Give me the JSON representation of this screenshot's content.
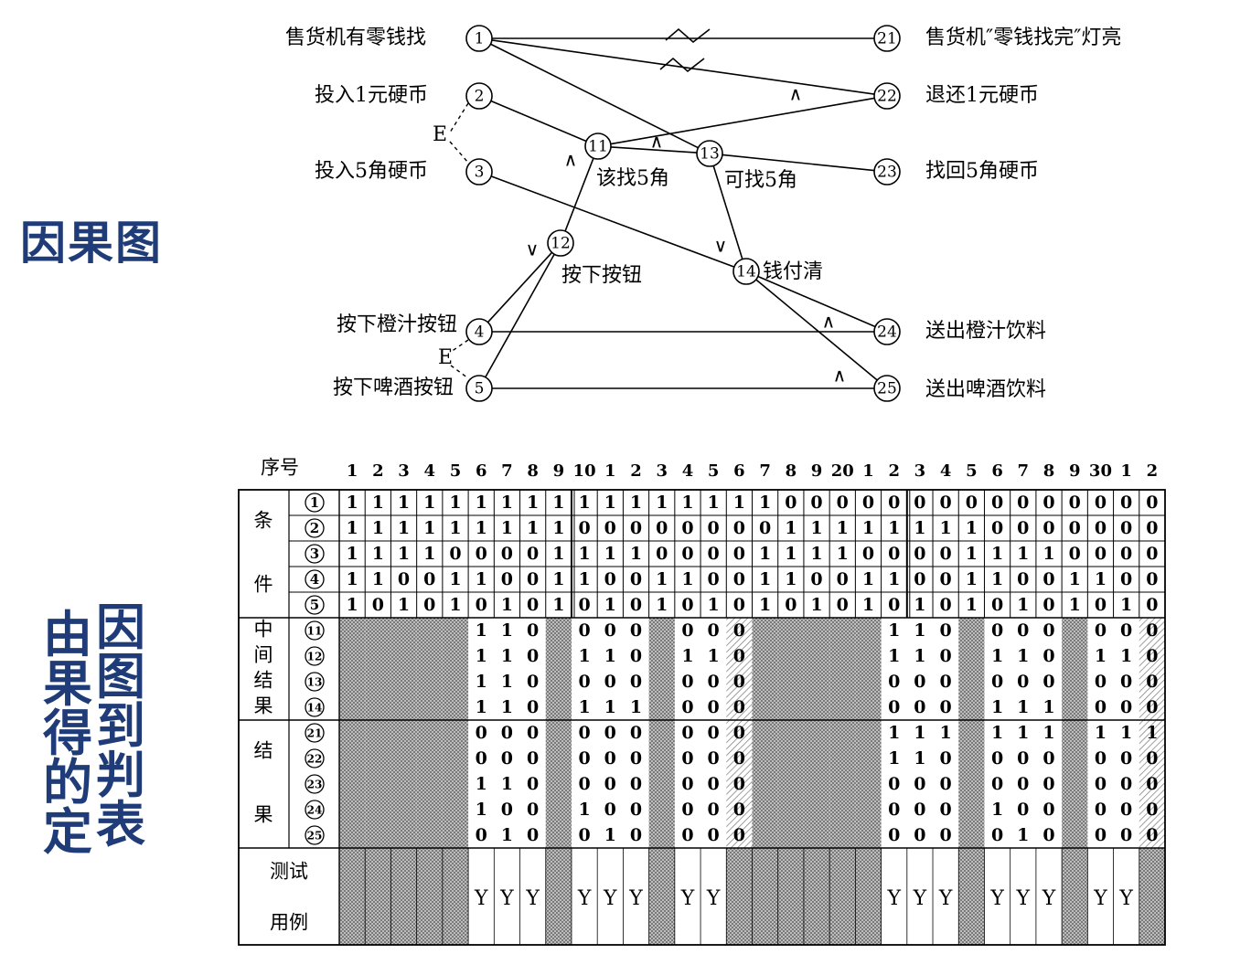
{
  "titles": {
    "cause_effect_graph": "因果图",
    "derive_table": "由因果图得到判定表"
  },
  "diagram": {
    "causes": [
      {
        "id": "1",
        "label": "售货机有零钱找"
      },
      {
        "id": "2",
        "label": "投入1元硬币"
      },
      {
        "id": "3",
        "label": "投入5角硬币"
      },
      {
        "id": "4",
        "label": "按下橙汁按钮"
      },
      {
        "id": "5",
        "label": "按下啤酒按钮"
      }
    ],
    "intermediates": [
      {
        "id": "11",
        "label": "该找5角"
      },
      {
        "id": "12",
        "label": "按下按钮"
      },
      {
        "id": "13",
        "label": "可找5角"
      },
      {
        "id": "14",
        "label": "钱付清"
      }
    ],
    "effects": [
      {
        "id": "21",
        "label": "售货机″零钱找完″灯亮"
      },
      {
        "id": "22",
        "label": "退还1元硬币"
      },
      {
        "id": "23",
        "label": "找回5角硬币"
      },
      {
        "id": "24",
        "label": "送出橙汁饮料"
      },
      {
        "id": "25",
        "label": "送出啤酒饮料"
      }
    ],
    "constraint_label": "E",
    "and_symbol": "∧",
    "or_symbol": "∨"
  },
  "table": {
    "header_label": "序号",
    "column_headers": [
      "1",
      "2",
      "3",
      "4",
      "5",
      "6",
      "7",
      "8",
      "9",
      "10",
      "1",
      "2",
      "3",
      "4",
      "5",
      "6",
      "7",
      "8",
      "9",
      "20",
      "1",
      "2",
      "3",
      "4",
      "5",
      "6",
      "7",
      "8",
      "9",
      "30",
      "1",
      "2"
    ],
    "conditions_label": [
      "条",
      "件"
    ],
    "intermediate_label": [
      "中",
      "间",
      "结",
      "果"
    ],
    "results_label": [
      "结",
      "果"
    ],
    "testcase_label": [
      "测试",
      "用例"
    ],
    "conditions": [
      {
        "id": "1",
        "values": [
          "1",
          "1",
          "1",
          "1",
          "1",
          "1",
          "1",
          "1",
          "1",
          "1",
          "1",
          "1",
          "1",
          "1",
          "1",
          "1",
          "1",
          "0",
          "0",
          "0",
          "0",
          "0",
          "0",
          "0",
          "0",
          "0",
          "0",
          "0",
          "0",
          "0",
          "0",
          "0"
        ]
      },
      {
        "id": "2",
        "values": [
          "1",
          "1",
          "1",
          "1",
          "1",
          "1",
          "1",
          "1",
          "1",
          "0",
          "0",
          "0",
          "0",
          "0",
          "0",
          "0",
          "0",
          "1",
          "1",
          "1",
          "1",
          "1",
          "1",
          "1",
          "1",
          "0",
          "0",
          "0",
          "0",
          "0",
          "0",
          "0"
        ]
      },
      {
        "id": "3",
        "values": [
          "1",
          "1",
          "1",
          "1",
          "0",
          "0",
          "0",
          "0",
          "1",
          "1",
          "1",
          "1",
          "0",
          "0",
          "0",
          "0",
          "1",
          "1",
          "1",
          "1",
          "0",
          "0",
          "0",
          "0",
          "1",
          "1",
          "1",
          "1",
          "0",
          "0",
          "0",
          "0"
        ]
      },
      {
        "id": "4",
        "values": [
          "1",
          "1",
          "0",
          "0",
          "1",
          "1",
          "0",
          "0",
          "1",
          "1",
          "0",
          "0",
          "1",
          "1",
          "0",
          "0",
          "1",
          "1",
          "0",
          "0",
          "1",
          "1",
          "0",
          "0",
          "1",
          "1",
          "0",
          "0",
          "1",
          "1",
          "0",
          "0"
        ]
      },
      {
        "id": "5",
        "values": [
          "1",
          "0",
          "1",
          "0",
          "1",
          "0",
          "1",
          "0",
          "1",
          "0",
          "1",
          "0",
          "1",
          "0",
          "1",
          "0",
          "1",
          "0",
          "1",
          "0",
          "1",
          "0",
          "1",
          "0",
          "1",
          "0",
          "1",
          "0",
          "1",
          "0",
          "1",
          "0"
        ]
      }
    ],
    "intermediates": [
      {
        "id": "11",
        "values": [
          "",
          "",
          "",
          "",
          "",
          "1",
          "1",
          "0",
          "",
          "0",
          "0",
          "0",
          "",
          "0",
          "0",
          "0",
          "",
          "",
          "",
          "",
          "",
          "1",
          "1",
          "0",
          "",
          "0",
          "0",
          "0",
          "",
          "0",
          "0",
          "0"
        ]
      },
      {
        "id": "12",
        "values": [
          "",
          "",
          "",
          "",
          "",
          "1",
          "1",
          "0",
          "",
          "1",
          "1",
          "0",
          "",
          "1",
          "1",
          "0",
          "",
          "",
          "",
          "",
          "",
          "1",
          "1",
          "0",
          "",
          "1",
          "1",
          "0",
          "",
          "1",
          "1",
          "0"
        ]
      },
      {
        "id": "13",
        "values": [
          "",
          "",
          "",
          "",
          "",
          "1",
          "1",
          "0",
          "",
          "0",
          "0",
          "0",
          "",
          "0",
          "0",
          "0",
          "",
          "",
          "",
          "",
          "",
          "0",
          "0",
          "0",
          "",
          "0",
          "0",
          "0",
          "",
          "0",
          "0",
          "0"
        ]
      },
      {
        "id": "14",
        "values": [
          "",
          "",
          "",
          "",
          "",
          "1",
          "1",
          "0",
          "",
          "1",
          "1",
          "1",
          "",
          "0",
          "0",
          "0",
          "",
          "",
          "",
          "",
          "",
          "0",
          "0",
          "0",
          "",
          "1",
          "1",
          "1",
          "",
          "0",
          "0",
          "0"
        ]
      }
    ],
    "results": [
      {
        "id": "21",
        "values": [
          "",
          "",
          "",
          "",
          "",
          "0",
          "0",
          "0",
          "",
          "0",
          "0",
          "0",
          "",
          "0",
          "0",
          "0",
          "",
          "",
          "",
          "",
          "",
          "1",
          "1",
          "1",
          "",
          "1",
          "1",
          "1",
          "",
          "1",
          "1",
          "1"
        ]
      },
      {
        "id": "22",
        "values": [
          "",
          "",
          "",
          "",
          "",
          "0",
          "0",
          "0",
          "",
          "0",
          "0",
          "0",
          "",
          "0",
          "0",
          "0",
          "",
          "",
          "",
          "",
          "",
          "1",
          "1",
          "0",
          "",
          "0",
          "0",
          "0",
          "",
          "0",
          "0",
          "0"
        ]
      },
      {
        "id": "23",
        "values": [
          "",
          "",
          "",
          "",
          "",
          "1",
          "1",
          "0",
          "",
          "0",
          "0",
          "0",
          "",
          "0",
          "0",
          "0",
          "",
          "",
          "",
          "",
          "",
          "0",
          "0",
          "0",
          "",
          "0",
          "0",
          "0",
          "",
          "0",
          "0",
          "0"
        ]
      },
      {
        "id": "24",
        "values": [
          "",
          "",
          "",
          "",
          "",
          "1",
          "0",
          "0",
          "",
          "1",
          "0",
          "0",
          "",
          "0",
          "0",
          "0",
          "",
          "",
          "",
          "",
          "",
          "0",
          "0",
          "0",
          "",
          "1",
          "0",
          "0",
          "",
          "0",
          "0",
          "0"
        ]
      },
      {
        "id": "25",
        "values": [
          "",
          "",
          "",
          "",
          "",
          "0",
          "1",
          "0",
          "",
          "0",
          "1",
          "0",
          "",
          "0",
          "0",
          "0",
          "",
          "",
          "",
          "",
          "",
          "0",
          "0",
          "0",
          "",
          "0",
          "1",
          "0",
          "",
          "0",
          "0",
          "0"
        ]
      }
    ],
    "testcases": [
      "",
      "",
      "",
      "",
      "",
      "Y",
      "Y",
      "Y",
      "",
      "Y",
      "Y",
      "Y",
      "",
      "Y",
      "Y",
      "",
      "",
      "",
      "",
      "",
      "",
      "Y",
      "Y",
      "Y",
      "",
      "Y",
      "Y",
      "Y",
      "",
      "Y",
      "Y",
      ""
    ],
    "infeasible_columns": [
      1,
      2,
      3,
      4,
      5,
      9,
      13,
      17,
      18,
      19,
      20,
      21,
      25,
      29
    ],
    "hatched_columns": [
      16,
      32
    ]
  }
}
